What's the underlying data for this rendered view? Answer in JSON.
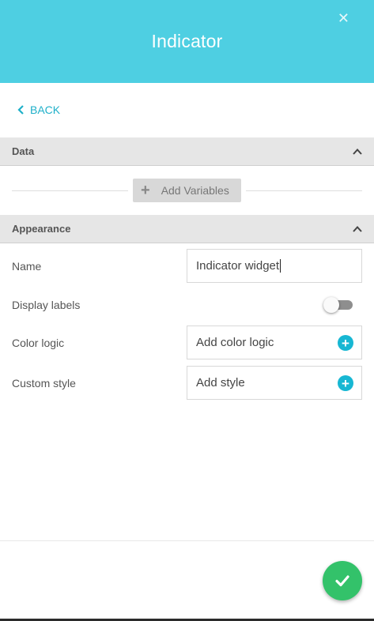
{
  "colors": {
    "accent": "#4ecfe2",
    "link": "#1fb0c9",
    "add_icon": "#17b7d3",
    "confirm": "#33c26a"
  },
  "header": {
    "title": "Indicator",
    "close_icon": "close-icon"
  },
  "back": {
    "label": "BACK",
    "icon": "chevron-left-icon"
  },
  "data_section": {
    "title": "Data",
    "add_variables_label": "Add Variables"
  },
  "appearance_section": {
    "title": "Appearance",
    "name_label": "Name",
    "name_value": "Indicator widget",
    "display_labels_label": "Display labels",
    "display_labels_on": false,
    "color_logic_label": "Color logic",
    "color_logic_placeholder": "Add color logic",
    "custom_style_label": "Custom style",
    "custom_style_placeholder": "Add style"
  },
  "footer": {
    "confirm_icon": "check-icon"
  }
}
